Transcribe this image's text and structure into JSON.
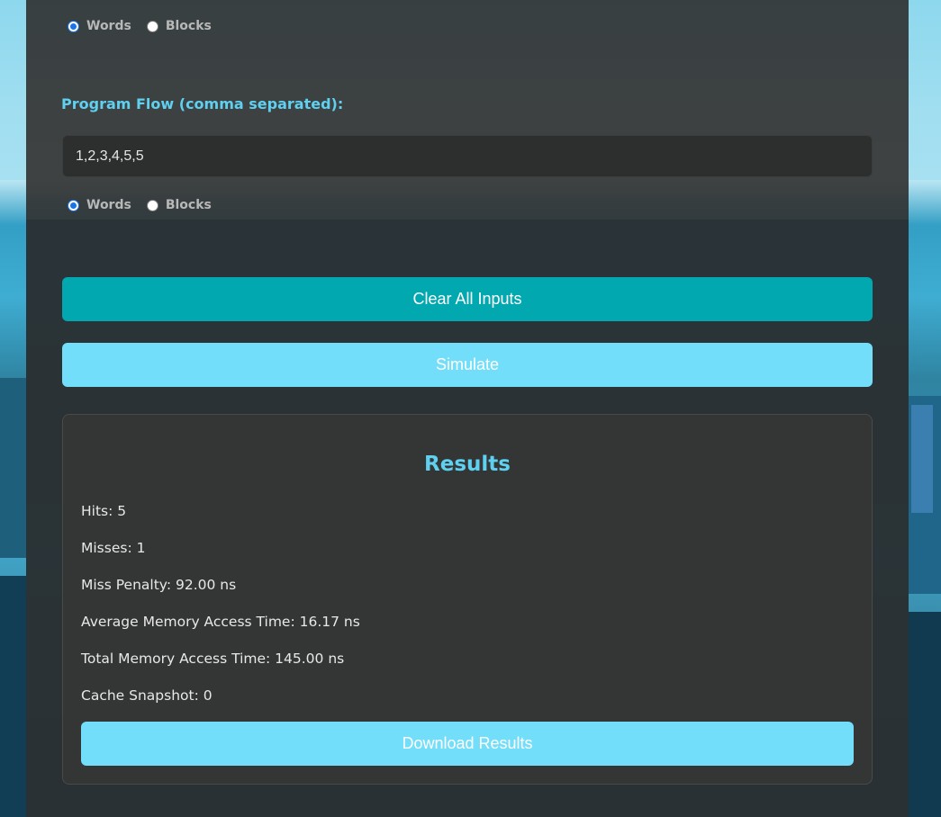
{
  "block_size_unit": {
    "options": [
      "Words",
      "Blocks"
    ],
    "selected": "Words"
  },
  "program_flow": {
    "label": "Program Flow (comma separated):",
    "value": "1,2,3,4,5,5",
    "unit_options": [
      "Words",
      "Blocks"
    ],
    "unit_selected": "Words"
  },
  "buttons": {
    "clear": "Clear All Inputs",
    "simulate": "Simulate",
    "download": "Download Results"
  },
  "results": {
    "title": "Results",
    "hits": "Hits: 5",
    "misses": "Misses: 1",
    "miss_penalty": "Miss Penalty: 92.00 ns",
    "avg_access_time": "Average Memory Access Time: 16.17 ns",
    "total_access_time": "Total Memory Access Time: 145.00 ns",
    "cache_snapshot": "Cache Snapshot: 0"
  },
  "colors": {
    "accent": "#5fd0f0",
    "clear_button": "#02a8b0",
    "simulate_button": "#72def9",
    "panel": "#323434"
  }
}
